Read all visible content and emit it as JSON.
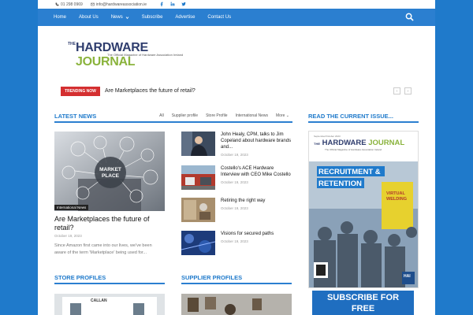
{
  "topbar": {
    "phone": "01 298 0969",
    "email": "info@hardwareassociation.ie",
    "socials": [
      "facebook-icon",
      "linkedin-icon",
      "twitter-icon"
    ]
  },
  "nav": {
    "items": [
      {
        "label": "Home"
      },
      {
        "label": "About Us"
      },
      {
        "label": "News",
        "has_dropdown": true
      },
      {
        "label": "Subscribe"
      },
      {
        "label": "Advertise"
      },
      {
        "label": "Contact Us"
      }
    ]
  },
  "logo": {
    "the": "THE",
    "hardware": "HARDWARE",
    "journal": "JOURNAL",
    "tagline": "The Official Magazine of Hardware Association Ireland"
  },
  "trending": {
    "badge": "TRENDING NOW",
    "headline": "Are Marketplaces the future of retail?",
    "prev": "‹",
    "next": "›"
  },
  "latest": {
    "title": "LATEST NEWS",
    "tabs": [
      "All",
      "Supplier profile",
      "Store Profile",
      "International News",
      "More"
    ]
  },
  "featured": {
    "category": "International News",
    "title": "Are Marketplaces the future of retail?",
    "date": "October 19, 2023",
    "excerpt": "Since Amazon first came into our lives, we've been aware of the term 'Marketplace' being used for...",
    "image_label": "MARKET PLACE"
  },
  "list": [
    {
      "title": "John Healy, CPM, talks to Jim Copeland about hardware brands and...",
      "date": "October 19, 2023"
    },
    {
      "title": "Costello's ACE Hardware Interview with CEO Mike Costello",
      "date": "October 19, 2023"
    },
    {
      "title": "Retiring the right way",
      "date": "October 19, 2023"
    },
    {
      "title": "Visions for secured paths",
      "date": "October 19, 2023"
    }
  ],
  "read_issue": {
    "title": "READ THE CURRENT ISSUE...",
    "cover_small": "September/October 2023",
    "cover_name_a": "HARDWARE",
    "cover_name_b": "JOURNAL",
    "cover_the": "THE",
    "cover_tag": "The Official Magazine of Hardware Association Ireland",
    "cover_headline_1": "RECRUITMENT &",
    "cover_headline_2": "RETENTION",
    "cover_side_1": "VIRTUAL",
    "cover_side_2": "WELDING",
    "cover_badge": "HAI"
  },
  "subscribe": {
    "line1": "SUBSCRIBE FOR",
    "line2": "FREE"
  },
  "store_profiles": {
    "title": "STORE PROFILES",
    "thumb_text": "CALLAN"
  },
  "supplier_profiles": {
    "title": "SUPPLIER PROFILES"
  },
  "colors": {
    "brand_blue": "#1f7acb",
    "trending_red": "#d42f30",
    "logo_navy": "#2f3d6e",
    "logo_green": "#8ab33c"
  }
}
